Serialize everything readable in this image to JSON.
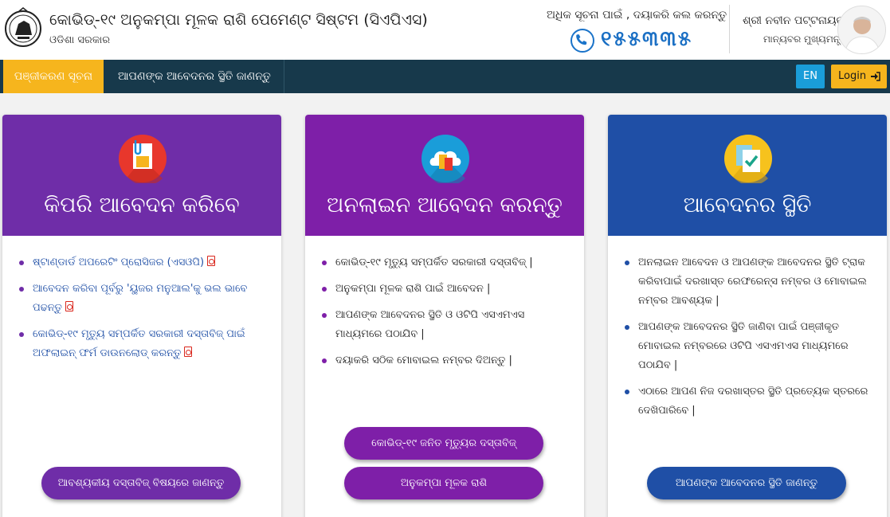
{
  "header": {
    "title": "କୋଭିଡ୍-୧୯ ଅନୁକମ୍ପା ମୂଳକ ରାଶି ପେମେଣ୍ଟ ସିଷ୍ଟମ (ସିଏପିଏସ)",
    "subtitle": "ଓଡିଶା ସରକାର",
    "helpline_text": "ଅଧିକ ସୂଚନା ପାଇଁ , ଦୟାକରି କଲ କରନ୍ତୁ",
    "helpline_number": "୧୫୫୩୩୫",
    "cm_name": "ଶ୍ରୀ ନବୀନ ପଟ୍ଟନାୟକ",
    "cm_title": "ମାନ୍ୟବର ମୁଖ୍ୟମନ୍ତ୍ରୀ"
  },
  "nav": {
    "tabs": [
      {
        "label": "ପଞ୍ଜୀକରଣ ସୂଚନା",
        "active": true
      },
      {
        "label": "ଆପଣଙ୍କ ଆବେଦନର ସ୍ଥିତି ଜାଣନ୍ତୁ",
        "active": false
      }
    ],
    "lang_label": "EN",
    "login_label": "Login"
  },
  "cards": [
    {
      "title": "କିପରି ଆବେଦନ କରିବେ",
      "color": "#6f2da8",
      "bullet_color": "#6f2da8",
      "icon": "document-icon",
      "items": [
        {
          "text": "ଷ୍ଟାଣ୍ଡାର୍ଡ ଅପରେଟିଂ ପ୍ରୋସିଜର (ଏସଓପି)",
          "pdf": true
        },
        {
          "text": "ଆବେଦନ କରିବା ପୂର୍ବରୁ 'ୟୁଜର ମନୁଆଲ'କୁ ଭଲ ଭାବେ ପଢନ୍ତୁ",
          "pdf": true
        },
        {
          "text": "କୋଭିଡ୍-୧୯ ମୃତ୍ୟୁ ସମ୍ପର୍କିତ ସରକାରୀ ଦସ୍ତାବିଜ୍ ପାଇଁ ଅଫଲାଇନ୍ ଫର୍ମ ଡାଉନଲୋଡ୍ କରନ୍ତୁ",
          "pdf": true
        }
      ],
      "buttons": [
        "ଆବଶ୍ୟକୀୟ ଦସ୍ତାବିଜ୍ ବିଷୟରେ ଜାଣନ୍ତୁ"
      ]
    },
    {
      "title": "ଅନଲାଇନ ଆବେଦନ କରନ୍ତୁ",
      "color": "#7e1fa8",
      "bullet_color": "#7e1fa8",
      "icon": "cloud-upload-icon",
      "items": [
        {
          "text": "କୋଭିଡ୍-୧୯ ମୃତ୍ୟୁ ସମ୍ପର୍କିତ ସରକାରୀ ଦସ୍ତାବିଜ୍ |",
          "pdf": false
        },
        {
          "text": "ଅନୁକମ୍ପା ମୂଳକ ରାଶି ପାଇଁ ଆବେଦନ |",
          "pdf": false
        },
        {
          "text": "ଆପଣଙ୍କ ଆବେଦନର ସ୍ଥିତି ଓ ଓଟିପି ଏସଏମଏସ ମାଧ୍ୟମରେ ପଠାଯିବ |",
          "pdf": false
        },
        {
          "text": "ଦୟାକରି ସଠିକ ମୋବାଇଲ ନମ୍ବର ଦିଅନ୍ତୁ |",
          "pdf": false
        }
      ],
      "buttons": [
        "କୋଭିଡ୍-୧୯ ଜନିତ ମୃତ୍ୟୁର ଦସ୍ତାବିଜ୍",
        "ଅନୁକମ୍ପା ମୂଳକ ରାଶି"
      ]
    },
    {
      "title": "ଆବେଦନର ସ୍ଥିତି",
      "color": "#1f4fa6",
      "bullet_color": "#1f4fa6",
      "icon": "status-check-icon",
      "items": [
        {
          "text": "ଅନଲାଇନ ଆବେଦନ ଓ ଆପଣଙ୍କ ଆବେଦନର ସ୍ଥିତି ଟ୍ରାକ କରିବାପାଇଁ ଦରଖାସ୍ତ ରେଫରେନ୍ସ ନମ୍ବର ଓ ମୋବାଇଲ ନମ୍ବର ଆବଶ୍ୟକ |",
          "pdf": false
        },
        {
          "text": "ଆପଣଙ୍କ ଆବେଦନର ସ୍ଥିତି ଜାଣିବା ପାଇଁ ପଞ୍ଜୀକୃତ ମୋବାଇଲ ନମ୍ବରରେ ଓଟିପି ଏସଏମଏସ ମାଧ୍ୟମରେ ପଠାଯିବ |",
          "pdf": false
        },
        {
          "text": "ଏଠାରେ ଆପଣ ନିଜ ଦରଖାସ୍ତର ସ୍ଥିତି ପ୍ରତ୍ୟେକ ସ୍ତରରେ ଦେଖିପାରିବେ |",
          "pdf": false
        }
      ],
      "buttons": [
        "ଆପଣଙ୍କ ଆବେଦନର ସ୍ଥିତି ଜାଣନ୍ତୁ"
      ]
    }
  ]
}
